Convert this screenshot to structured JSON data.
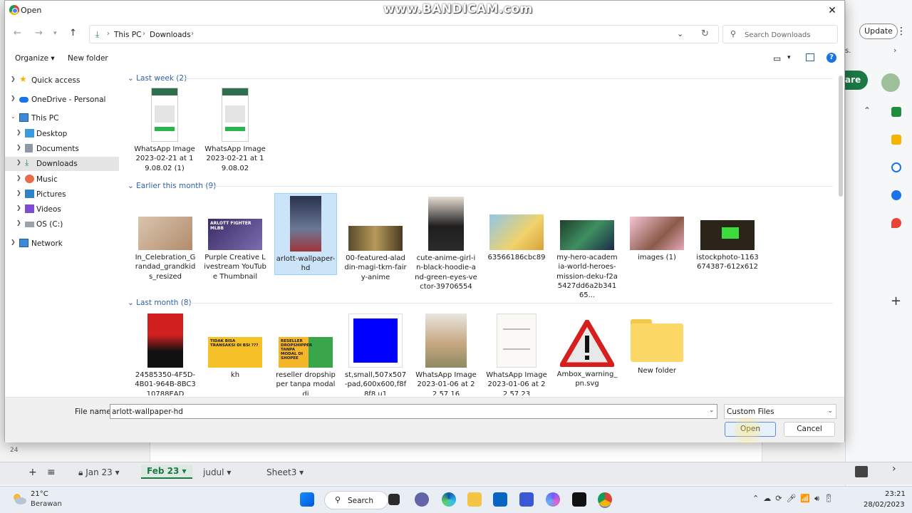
{
  "watermark": "www.BANDICAM.com",
  "background_app": {
    "update_label": "Update",
    "menu_glyph": "⋮",
    "truncated_text": "s.",
    "share_partial": "are",
    "row_number": "24",
    "sheet_tabs": [
      "Jan 23",
      "Feb 23",
      "judul",
      "Sheet3"
    ]
  },
  "dialog": {
    "title": "Open",
    "address": {
      "crumbs": [
        "This PC",
        "Downloads"
      ]
    },
    "search": {
      "placeholder": "Search Downloads"
    },
    "toolbar": {
      "organize": "Organize ▾",
      "new_folder": "New folder"
    },
    "nav": [
      {
        "label": "Quick access",
        "icon": "star-icon"
      },
      {
        "label": "OneDrive - Personal",
        "icon": "cloud-icon"
      },
      {
        "label": "This PC",
        "icon": "computer-icon"
      },
      {
        "label": "Desktop",
        "icon": "desktop-icon"
      },
      {
        "label": "Documents",
        "icon": "documents-icon"
      },
      {
        "label": "Downloads",
        "icon": "download-icon"
      },
      {
        "label": "Music",
        "icon": "music-icon"
      },
      {
        "label": "Pictures",
        "icon": "pictures-icon"
      },
      {
        "label": "Videos",
        "icon": "videos-icon"
      },
      {
        "label": "OS (C:)",
        "icon": "drive-icon"
      },
      {
        "label": "Network",
        "icon": "network-icon"
      }
    ],
    "groups": [
      {
        "label": "Last week (2)",
        "files": [
          {
            "name": "WhatsApp Image 2023-02-21 at 19.08.02 (1)"
          },
          {
            "name": "WhatsApp Image 2023-02-21 at 19.08.02"
          }
        ]
      },
      {
        "label": "Earlier this month (9)",
        "files": [
          {
            "name": "In_Celebration_Grandad_grandkids_resized"
          },
          {
            "name": "Purple Creative Livestream YouTube Thumbnail"
          },
          {
            "name": "arlott-wallpaper-hd"
          },
          {
            "name": "00-featured-aladdin-magi-tkm-fairy-anime"
          },
          {
            "name": "cute-anime-girl-in-black-hoodie-and-green-eyes-vector-39706554"
          },
          {
            "name": "63566186cbc89"
          },
          {
            "name": "my-hero-academia-world-heroes-mission-deku-f2a5427dd6a2b34165..."
          },
          {
            "name": "images (1)"
          },
          {
            "name": "istockphoto-1163674387-612x612"
          }
        ]
      },
      {
        "label": "Last month (8)",
        "files": [
          {
            "name": "24585350-4F5D-4B01-964B-8BC310788EAD"
          },
          {
            "name": "kh"
          },
          {
            "name": "reseller dropshipper tanpa modal di"
          },
          {
            "name": "st,small,507x507-pad,600x600,f8f8f8.u1"
          },
          {
            "name": "WhatsApp Image 2023-01-06 at 22.57.16"
          },
          {
            "name": "WhatsApp Image 2023-01-06 at 22.57.23"
          },
          {
            "name": "Ambox_warning_pn.svg"
          },
          {
            "name": "New folder"
          }
        ]
      }
    ],
    "thumb_text": {
      "arlott": "ARLOTT FIGHTER MLBB",
      "kh": "TIDAK BISA TRANSAKSI DI BSI ???",
      "reseller": "RESELLER DROPSHIPPER TANPA MODAL DI SHOPEE"
    },
    "file_name_label": "File name:",
    "file_name_value": "arlott-wallpaper-hd",
    "file_type": "Custom Files",
    "open_label": "Open",
    "cancel_label": "Cancel"
  },
  "taskbar": {
    "temperature": "21°C",
    "condition": "Berawan",
    "search_label": "Search",
    "time": "23:21",
    "date": "28/02/2023"
  },
  "colors": {
    "accent": "#1a73e8",
    "selection": "#cce4f7",
    "sheets_green": "#1b7a43"
  }
}
